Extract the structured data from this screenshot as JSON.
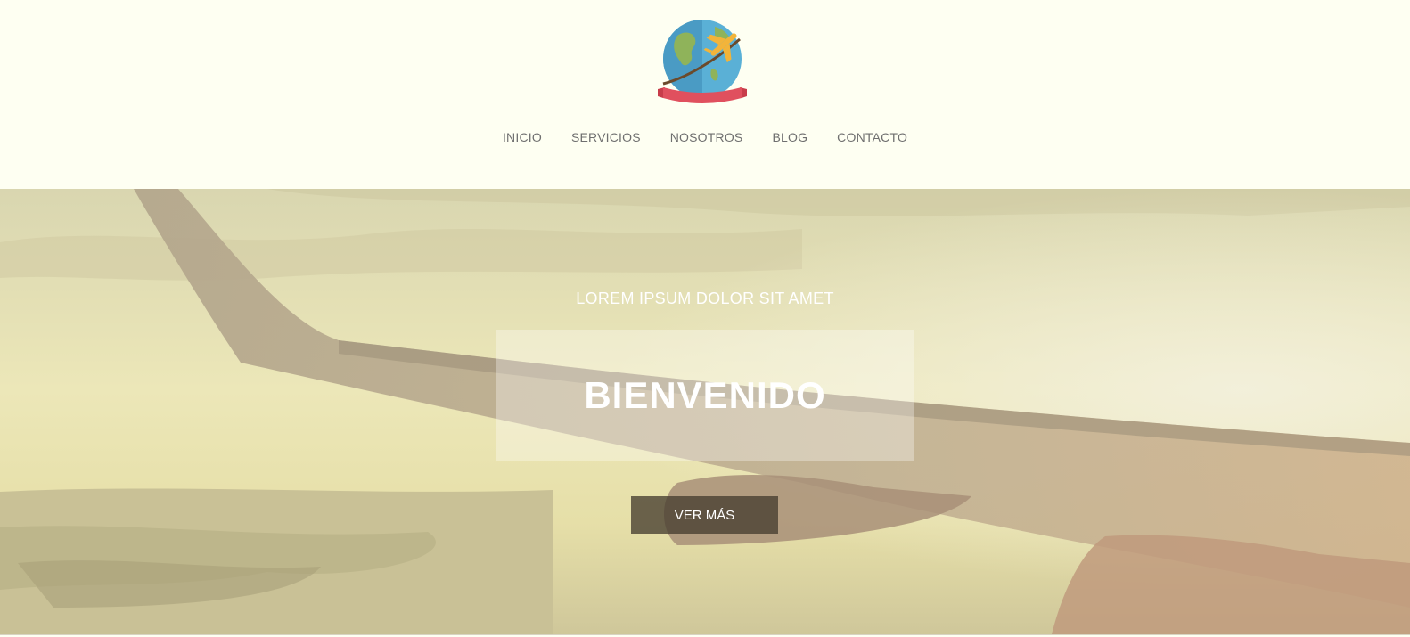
{
  "header": {
    "logo_icon": "globe-airplane-logo",
    "nav": [
      {
        "label": "INICIO"
      },
      {
        "label": "SERVICIOS"
      },
      {
        "label": "NOSOTROS"
      },
      {
        "label": "BLOG"
      },
      {
        "label": "CONTACTO"
      }
    ]
  },
  "hero": {
    "background": "airplane-wing-over-sea-photo",
    "subtitle": "LOREM IPSUM DOLOR SIT AMET",
    "title": "BIENVENIDO",
    "cta_label": "VER MÁS"
  },
  "colors": {
    "page_bg": "#fefff2",
    "nav_text": "#6f6f6f",
    "cta_bg": "#5a5242",
    "ribbon": "#e0505e",
    "globe_blue": "#5ab0d6",
    "plane": "#f2b43a"
  }
}
